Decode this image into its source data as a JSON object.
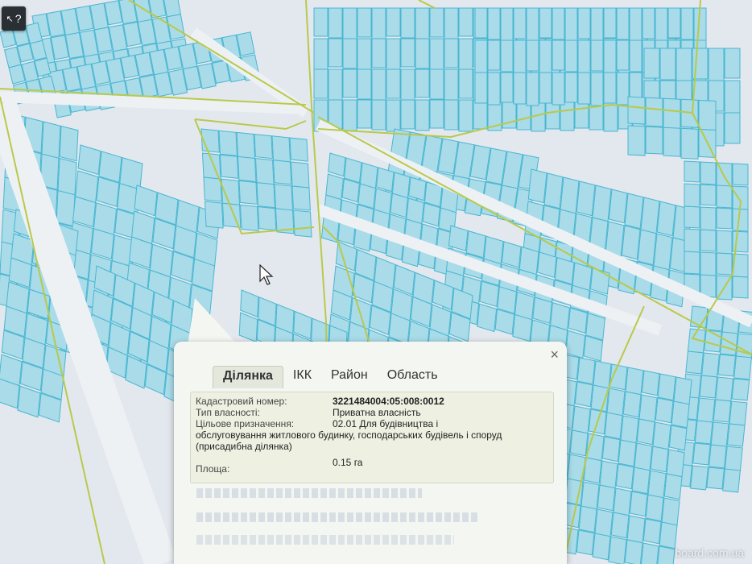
{
  "help_button": {
    "label": "?"
  },
  "popup": {
    "close_label": "×",
    "tabs": [
      {
        "label": "Ділянка",
        "active": true
      },
      {
        "label": "ІКК",
        "active": false
      },
      {
        "label": "Район",
        "active": false
      },
      {
        "label": "Область",
        "active": false
      }
    ],
    "cadastral": {
      "label": "Кадастровий номер:",
      "value": "3221484004:05:008:0012"
    },
    "ownership": {
      "label": "Тип власності:",
      "value": "Приватна власність"
    },
    "purpose": {
      "label": "Цільове призначення:",
      "value_line1": "02.01 Для будівництва і",
      "value_rest": "обслуговування житлового будинку, господарських будівель і споруд (присадибна ділянка)"
    },
    "area": {
      "label": "Площа:",
      "value": "0.15 га"
    }
  },
  "watermark": "board.com.ua",
  "colors": {
    "parcel_fill": "#a9dbe9",
    "parcel_stroke": "#49b6d1",
    "boundary": "#b9c94a",
    "map_bg": "#dfe6ec"
  }
}
